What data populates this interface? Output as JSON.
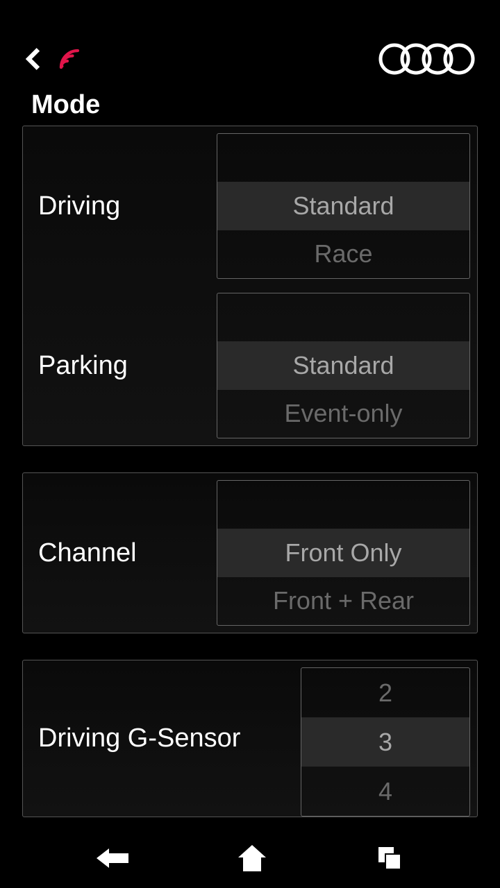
{
  "header": {
    "title": "Mode"
  },
  "groups": [
    {
      "rows": [
        {
          "label": "Driving",
          "options": [
            "",
            "Standard",
            "Race"
          ],
          "selected_index": 1
        },
        {
          "label": "Parking",
          "options": [
            "",
            "Standard",
            "Event-only"
          ],
          "selected_index": 1
        }
      ]
    },
    {
      "rows": [
        {
          "label": "Channel",
          "options": [
            "",
            "Front Only",
            "Front + Rear"
          ],
          "selected_index": 1
        }
      ]
    },
    {
      "rows": [
        {
          "label": "Driving G-Sensor",
          "options": [
            "2",
            "3",
            "4"
          ],
          "selected_index": 1,
          "narrow": true
        }
      ]
    }
  ]
}
